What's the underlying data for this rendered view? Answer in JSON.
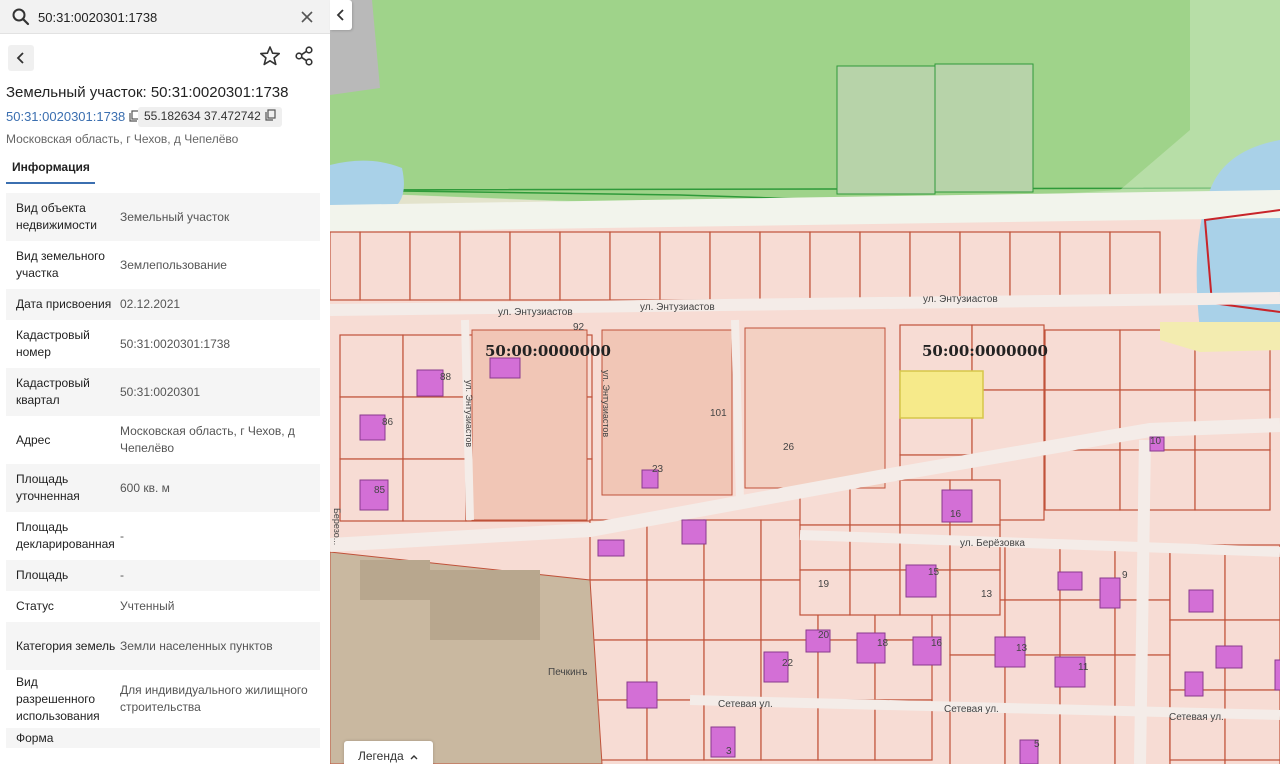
{
  "search": {
    "value": "50:31:0020301:1738",
    "icon": "search-icon",
    "clear_icon": "close-icon"
  },
  "nav": {
    "back_icon": "chevron-left-icon",
    "favorite_icon": "star-icon",
    "share_icon": "share-icon"
  },
  "object": {
    "title": "Земельный участок: 50:31:0020301:1738",
    "cadastral_number": "50:31:0020301:1738",
    "coordinates": "55.182634 37.472742",
    "address": "Московская область, г Чехов, д Чепелёво"
  },
  "tabs": [
    {
      "label": "Информация",
      "active": true
    }
  ],
  "info_rows": [
    {
      "key": "Вид объекта недвижимости",
      "value": "Земельный участок"
    },
    {
      "key": "Вид земельного участка",
      "value": "Землепользование"
    },
    {
      "key": "Дата присвоения",
      "value": "02.12.2021"
    },
    {
      "key": "Кадастровый номер",
      "value": "50:31:0020301:1738"
    },
    {
      "key": "Кадастровый квартал",
      "value": "50:31:0020301"
    },
    {
      "key": "Адрес",
      "value": "Московская область, г Чехов, д Чепелёво"
    },
    {
      "key": "Площадь уточненная",
      "value": "600 кв. м"
    },
    {
      "key": "Площадь декларированная",
      "value": "-"
    },
    {
      "key": "Площадь",
      "value": "-"
    },
    {
      "key": "Статус",
      "value": "Учтенный"
    },
    {
      "key": "Категория земель",
      "value": "Земли населенных пунктов"
    },
    {
      "key": "Вид разрешенного использования",
      "value": "Для индивидуального жилищного строительства"
    },
    {
      "key": "Форма",
      "value": ""
    }
  ],
  "map": {
    "collapse_icon": "chevron-left-icon",
    "legend_label": "Легенда",
    "legend_icon": "chevron-up-icon",
    "quarter_labels": [
      "50:00:0000000",
      "50:00:0000000"
    ],
    "street_labels": [
      "ул. Энтузиастов",
      "ул. Энтузиастов",
      "ул. Энтузиастов",
      "ул. Энтузиастов",
      "ул. Энтузиастов",
      "ул. Берёзовка",
      "Сетевая ул.",
      "Сетевая ул.",
      "Сетевая ул.",
      "Березо..."
    ],
    "place_label": "Печкинъ",
    "plot_numbers": [
      "92",
      "88",
      "101",
      "26",
      "86",
      "23",
      "85",
      "10",
      "16",
      "19",
      "15",
      "13",
      "9",
      "20",
      "18",
      "16",
      "22",
      "13",
      "11",
      "3",
      "5"
    ],
    "colors": {
      "forest": "#9fd38a",
      "forest_edge": "#2f9a3a",
      "road": "#f4f6ee",
      "parcel_fill": "#f7dcd4",
      "parcel_edge": "#c0523a",
      "selected": "#f6ea8a",
      "building": "#d36fd6",
      "water": "#a9d1e8",
      "industrial": "#c9b8a0"
    }
  }
}
